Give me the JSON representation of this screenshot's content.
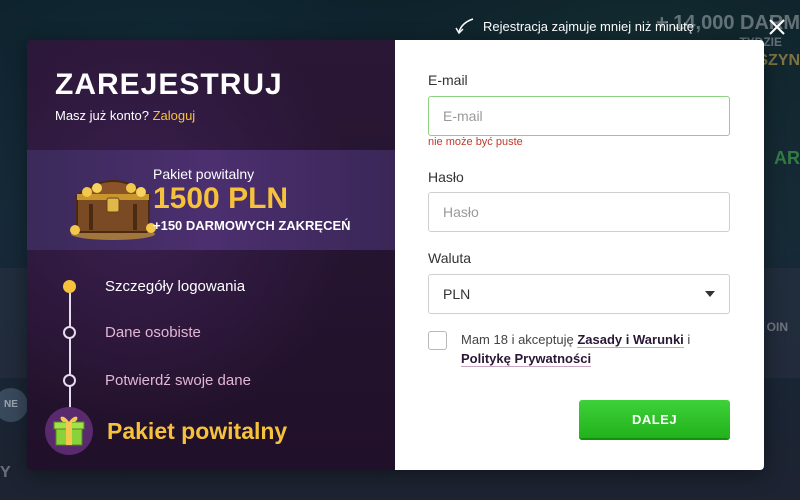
{
  "background": {
    "promo_line1": "+ 14,000 DARM",
    "promo_line2": "TYDZIE",
    "promo_line3": "SZYN",
    "promo_line4": "AR",
    "left_badge": "NE",
    "right_text": "OIN",
    "bottom_text": "Y"
  },
  "top_hint": {
    "text": "Rejestracja zajmuje mniej niż minutę",
    "arrow_icon": "curved-arrow-icon",
    "close_icon": "close-icon"
  },
  "left_panel": {
    "title": "ZAREJESTRUJ",
    "subtitle": "Masz już konto?",
    "login_link": "Zaloguj",
    "banner": {
      "pakiet": "Pakiet powitalny",
      "amount": "1500 PLN",
      "spins": "+150 DARMOWYCH ZAKRĘCEŃ"
    },
    "steps": [
      {
        "label": "Szczegóły logowania",
        "active": true
      },
      {
        "label": "Dane osobiste",
        "active": false
      },
      {
        "label": "Potwierdź swoje dane",
        "active": false
      }
    ],
    "gift_label": "Pakiet powitalny"
  },
  "form": {
    "email_label": "E-mail",
    "email_placeholder": "E-mail",
    "email_value": "",
    "email_error": "nie może być puste",
    "password_label": "Hasło",
    "password_placeholder": "Hasło",
    "currency_label": "Waluta",
    "currency_value": "PLN",
    "terms_prefix": "Mam 18 i akceptuję",
    "terms_link1": "Zasady i Warunki",
    "terms_and": "i",
    "terms_link2": "Politykę Prywatności",
    "submit_label": "DALEJ"
  },
  "colors": {
    "accent_yellow": "#f7c23b",
    "submit_green": "#2fbf29",
    "error_red": "#c0392b",
    "panel_purple": "#2a1736"
  }
}
